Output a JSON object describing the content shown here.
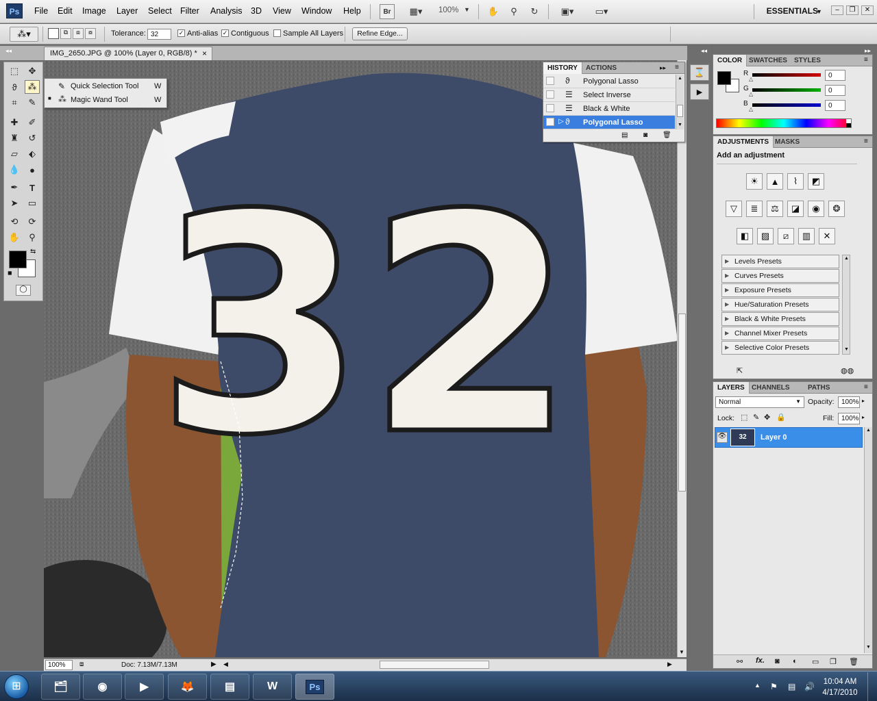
{
  "app": {
    "logo_text": "Ps",
    "workspace": "ESSENTIALS"
  },
  "menu": [
    "File",
    "Edit",
    "Image",
    "Layer",
    "Select",
    "Filter",
    "Analysis",
    "3D",
    "View",
    "Window",
    "Help"
  ],
  "menubar_tools": {
    "bridge_label": "Br",
    "zoom": "100%"
  },
  "options": {
    "tolerance_label": "Tolerance:",
    "tolerance_value": "32",
    "anti_alias_label": "Anti-alias",
    "anti_alias_checked": true,
    "contiguous_label": "Contiguous",
    "contiguous_checked": true,
    "sample_all_layers_label": "Sample All Layers",
    "sample_all_layers_checked": false,
    "refine_edge_label": "Refine Edge..."
  },
  "document": {
    "tab_title": "IMG_2650.JPG @ 100% (Layer 0, RGB/8) *",
    "close_glyph": "×"
  },
  "tool_flyout": [
    {
      "label": "Quick Selection Tool",
      "shortcut": "W",
      "current": false
    },
    {
      "label": "Magic Wand Tool",
      "shortcut": "W",
      "current": true
    }
  ],
  "canvas_image": {
    "jersey_number": "32"
  },
  "status": {
    "zoom": "100%",
    "doc_size": "Doc: 7.13M/7.13M"
  },
  "history_panel": {
    "tabs": [
      "HISTORY",
      "ACTIONS"
    ],
    "items": [
      {
        "label": "Polygonal Lasso",
        "selected": false
      },
      {
        "label": "Select Inverse",
        "selected": false
      },
      {
        "label": "Black & White",
        "selected": false
      },
      {
        "label": "Polygonal Lasso",
        "selected": true
      }
    ]
  },
  "color_panel": {
    "tabs": [
      "COLOR",
      "SWATCHES",
      "STYLES"
    ],
    "channels": [
      {
        "label": "R",
        "value": "0",
        "color": "#d40000"
      },
      {
        "label": "G",
        "value": "0",
        "color": "#00b000"
      },
      {
        "label": "B",
        "value": "0",
        "color": "#0000d0"
      }
    ]
  },
  "adjustments_panel": {
    "tabs": [
      "ADJUSTMENTS",
      "MASKS"
    ],
    "heading": "Add an adjustment",
    "presets": [
      "Levels Presets",
      "Curves Presets",
      "Exposure Presets",
      "Hue/Saturation Presets",
      "Black & White Presets",
      "Channel Mixer Presets",
      "Selective Color Presets"
    ]
  },
  "layers_panel": {
    "tabs": [
      "LAYERS",
      "CHANNELS",
      "PATHS"
    ],
    "blend_mode": "Normal",
    "opacity_label": "Opacity:",
    "opacity_value": "100%",
    "lock_label": "Lock:",
    "fill_label": "Fill:",
    "fill_value": "100%",
    "layer_name": "Layer 0",
    "thumb_text": "32"
  },
  "taskbar": {
    "time": "10:04 AM",
    "date": "4/17/2010",
    "ps_label": "Ps"
  }
}
